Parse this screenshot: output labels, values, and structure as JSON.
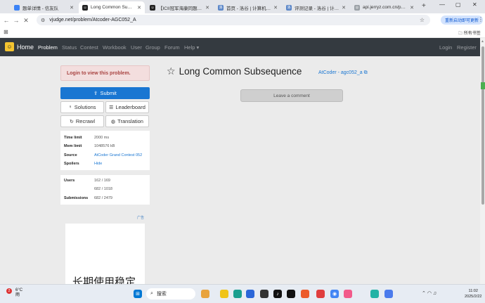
{
  "browser": {
    "tabs": [
      {
        "title": "题单详情 - 信友队",
        "active": false,
        "color": "#3b82f6"
      },
      {
        "title": "Long Common Subseque",
        "active": true,
        "color": "#222222"
      },
      {
        "title": "【ICII冠军海康同题算法",
        "active": false,
        "color": "#222222"
      },
      {
        "title": "首页 - 洛谷 | 计算机科学",
        "active": false,
        "color": "#5a86c8"
      },
      {
        "title": "评测记录 - 洛谷 | 计算机",
        "active": false,
        "color": "#5a86c8"
      },
      {
        "title": "api.jerryz.com.cn/practi",
        "active": false,
        "color": "#9aa0a6"
      }
    ],
    "url": "vjudge.net/problem/Atcoder-AGC052_A",
    "update_button": "重新启动即可更新",
    "all_bookmarks": "所有书签"
  },
  "site": {
    "brand": "Home",
    "nav": [
      "Problem",
      "Status",
      "Contest",
      "Workbook",
      "User",
      "Group",
      "Forum",
      "Help"
    ],
    "login": "Login",
    "register": "Register"
  },
  "problem": {
    "login_alert": "Login to view this problem.",
    "submit": "Submit",
    "solutions": "Solutions",
    "leaderboard": "Leaderboard",
    "recrawl": "Recrawl",
    "translation": "Translation",
    "info": [
      {
        "key": "Time limit",
        "value": "2000 ms",
        "link": false
      },
      {
        "key": "Mem limit",
        "value": "1048576 kB",
        "link": false
      },
      {
        "key": "Source",
        "value": "AtCoder Grand Contest 052",
        "link": true
      },
      {
        "key": "Spoilers",
        "value": "Hide",
        "link": true
      }
    ],
    "stats": [
      {
        "key": "Users",
        "value": "162 / 169"
      },
      {
        "key": "",
        "value": "682 / 1018"
      },
      {
        "key": "Submissions",
        "value": "682 / 2479"
      }
    ],
    "ad_tag": "广告",
    "ad_text": "长期使用稳定",
    "title": "Long Common Subsequence",
    "origin": "AtCoder - agc052_a",
    "leave_comment": "Leave a comment"
  },
  "taskbar": {
    "badge": "2",
    "temp": "6°C",
    "weather": "雨",
    "search": "搜索",
    "time": "11:02",
    "date": "2025/2/22"
  }
}
